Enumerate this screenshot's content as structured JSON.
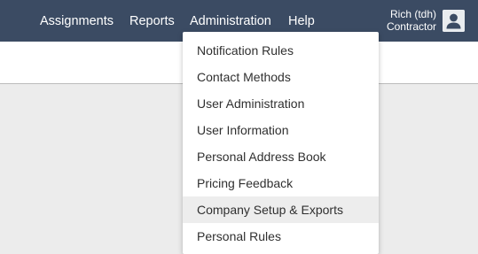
{
  "nav": {
    "items": [
      {
        "label": "Assignments"
      },
      {
        "label": "Reports"
      },
      {
        "label": "Administration"
      },
      {
        "label": "Help"
      }
    ]
  },
  "user": {
    "name": "Rich (tdh)",
    "role": "Contractor",
    "avatar_icon": "person-icon"
  },
  "admin_menu": {
    "items": [
      {
        "label": "Notification Rules"
      },
      {
        "label": "Contact Methods"
      },
      {
        "label": "User Administration"
      },
      {
        "label": "User Information"
      },
      {
        "label": "Personal Address Book"
      },
      {
        "label": "Pricing Feedback"
      },
      {
        "label": "Company Setup & Exports",
        "highlighted": true
      },
      {
        "label": "Personal Rules"
      }
    ]
  },
  "colors": {
    "topbar": "#3b4b63",
    "menu_highlight": "#ededed",
    "background": "#ececec"
  }
}
